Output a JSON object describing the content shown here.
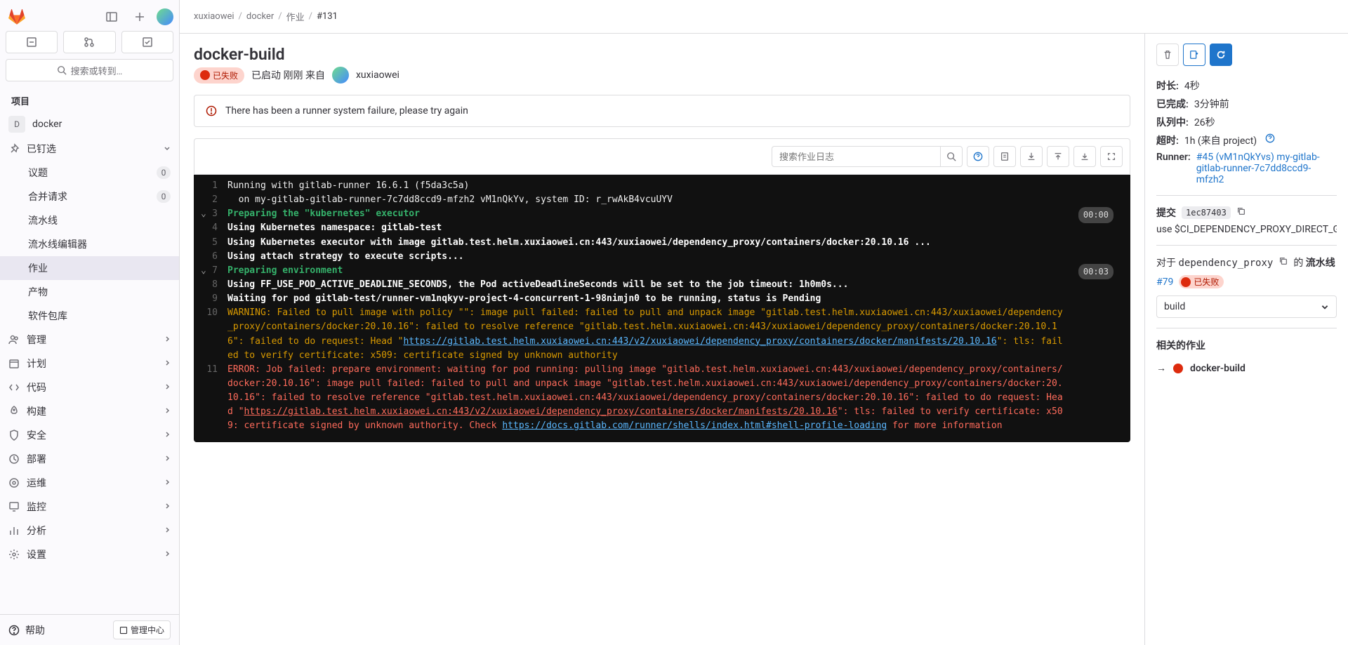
{
  "breadcrumb": [
    "xuxiaowei",
    "docker",
    "作业",
    "#131"
  ],
  "sidebar": {
    "search_placeholder": "搜索或转到…",
    "section_project": "项目",
    "project_name": "docker",
    "project_initial": "D",
    "pinned": "已钉选",
    "issues": "议题",
    "issues_badge": "0",
    "merge_requests": "合并请求",
    "mr_badge": "0",
    "pipelines": "流水线",
    "pipeline_editor": "流水线编辑器",
    "jobs": "作业",
    "artifacts": "产物",
    "package_registry": "软件包库",
    "manage": "管理",
    "plan": "计划",
    "code": "代码",
    "build": "构建",
    "secure": "安全",
    "deploy": "部署",
    "operate": "运维",
    "monitor": "监控",
    "analyze": "分析",
    "settings": "设置",
    "help": "帮助",
    "admin": "管理中心"
  },
  "page": {
    "title": "docker-build",
    "status": "已失败",
    "launched": "已启动 刚刚 来自",
    "author": "xuxiaowei",
    "alert": "There has been a runner system failure, please try again",
    "search_log_placeholder": "搜索作业日志"
  },
  "log": {
    "l1": "Running with gitlab-runner 16.6.1 (f5da3c5a)",
    "l2": "  on my-gitlab-gitlab-runner-7c7dd8ccd9-mfzh2 vM1nQkYv, system ID: r_rwAkB4vcuUYV",
    "l3": "Preparing the \"kubernetes\" executor",
    "t3": "00:00",
    "l4": "Using Kubernetes namespace: gitlab-test",
    "l5": "Using Kubernetes executor with image gitlab.test.helm.xuxiaowei.cn:443/xuxiaowei/dependency_proxy/containers/docker:20.10.16 ...",
    "l6": "Using attach strategy to execute scripts...",
    "l7": "Preparing environment",
    "t7": "00:03",
    "l8": "Using FF_USE_POD_ACTIVE_DEADLINE_SECONDS, the Pod activeDeadlineSeconds will be set to the job timeout: 1h0m0s...",
    "l9": "Waiting for pod gitlab-test/runner-vm1nqkyv-project-4-concurrent-1-98nimjn0 to be running, status is Pending",
    "l10a": "WARNING: Failed to pull image with policy \"\": image pull failed: failed to pull and unpack image \"gitlab.test.helm.xuxiaowei.cn:443/xuxiaowei/dependency_proxy/containers/docker:20.10.16\": failed to resolve reference \"gitlab.test.helm.xuxiaowei.cn:443/xuxiaowei/dependency_proxy/containers/docker:20.10.16\": failed to do request: Head \"",
    "l10link": "https://gitlab.test.helm.xuxiaowei.cn:443/v2/xuxiaowei/dependency_proxy/containers/docker/manifests/20.10.16",
    "l10b": "\": tls: failed to verify certificate: x509: certificate signed by unknown authority",
    "l11a": "ERROR: Job failed: prepare environment: waiting for pod running: pulling image \"gitlab.test.helm.xuxiaowei.cn:443/xuxiaowei/dependency_proxy/containers/docker:20.10.16\": image pull failed: failed to pull and unpack image \"gitlab.test.helm.xuxiaowei.cn:443/xuxiaowei/dependency_proxy/containers/docker:20.10.16\": failed to resolve reference \"gitlab.test.helm.xuxiaowei.cn:443/xuxiaowei/dependency_proxy/containers/docker:20.10.16\": failed to do request: Head \"",
    "l11link1": "https://gitlab.test.helm.xuxiaowei.cn:443/v2/xuxiaowei/dependency_proxy/containers/docker/manifests/20.10.16",
    "l11b": "\": tls: failed to verify certificate: x509: certificate signed by unknown authority. Check ",
    "l11link2": "https://docs.gitlab.com/runner/shells/index.html#shell-profile-loading",
    "l11c": " for more information"
  },
  "right": {
    "duration_k": "时长:",
    "duration_v": "4秒",
    "finished_k": "已完成:",
    "finished_v": "3分钟前",
    "queued_k": "队列中:",
    "queued_v": "26秒",
    "timeout_k": "超时:",
    "timeout_v": "1h (来自 project)",
    "runner_k": "Runner:",
    "runner_v": "#45 (vM1nQkYvs) my-gitlab-gitlab-runner-7c7dd8ccd9-mfzh2",
    "commit_k": "提交",
    "commit_sha": "1ec87403",
    "commit_msg": "use $CI_DEPENDENCY_PROXY_DIRECT_GROU",
    "for": "对于",
    "dp": "dependency_proxy",
    "of": "的",
    "pipeline": "流水线",
    "pipeline_num": "#79",
    "pipeline_status": "已失败",
    "stage": "build",
    "related_heading": "相关的作业",
    "related_job": "docker-build"
  }
}
